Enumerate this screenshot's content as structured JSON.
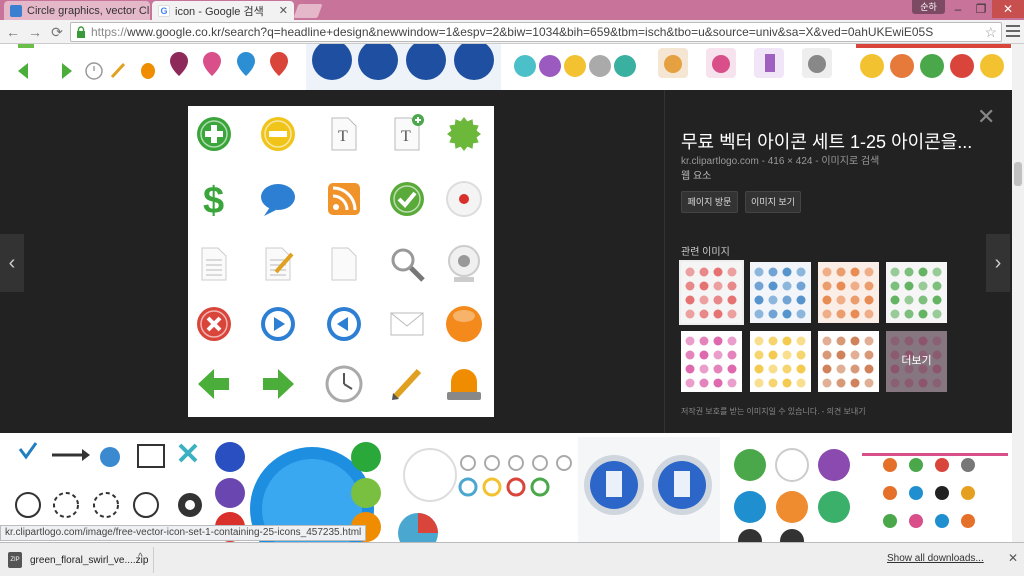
{
  "tabs": [
    {
      "title": "Circle graphics, vector Cli",
      "favicon_color": "#3b7fd0",
      "favicon": "image-icon",
      "active": false
    },
    {
      "title": "icon - Google 검색",
      "favicon_color": "#4285f4",
      "favicon": "google-icon",
      "active": true
    }
  ],
  "window": {
    "profile": "순하",
    "minimize": "–",
    "maximize": "❐",
    "close": "✕"
  },
  "toolbar": {
    "url_scheme": "https://",
    "url_rest": "www.google.co.kr/search?q=headline+design&newwindow=1&espv=2&biw=1034&bih=659&tbm=isch&tbo=u&source=univ&sa=X&ved=0ahUKEwiE05S",
    "back": "←",
    "forward": "→",
    "reload": "⟳",
    "star": "☆"
  },
  "preview": {
    "title": "무료 벡터 아이콘 세트 1-25 아이콘을...",
    "meta": "kr.clipartlogo.com - 416 × 424 - 이미지로 검색",
    "sub": "웹 요소",
    "visit_button": "페이지 방문",
    "view_button": "이미지 보기",
    "related_label": "관련 이미지",
    "more_label": "더보기",
    "copyright": "저작권 보호를 받는 이미지일 수 있습니다.  -  의견 보내기",
    "close": "✕",
    "prev": "‹",
    "next": "›"
  },
  "main_icons": [
    {
      "name": "plus-icon",
      "color": "#3aa53a"
    },
    {
      "name": "minus-icon",
      "color": "#f0c419"
    },
    {
      "name": "text-doc-icon",
      "color": "#bbbbbb"
    },
    {
      "name": "text-add-icon",
      "color": "#bbbbbb"
    },
    {
      "name": "seal-icon",
      "color": "#6cb83a"
    },
    {
      "name": "dollar-icon",
      "color": "#3aa53a"
    },
    {
      "name": "speech-bubble-icon",
      "color": "#2d7fd3"
    },
    {
      "name": "rss-icon",
      "color": "#f0932b"
    },
    {
      "name": "check-icon",
      "color": "#5aaa3a"
    },
    {
      "name": "record-icon",
      "color": "#dddddd"
    },
    {
      "name": "document-icon",
      "color": "#cccccc"
    },
    {
      "name": "edit-document-icon",
      "color": "#cccccc"
    },
    {
      "name": "blank-page-icon",
      "color": "#cccccc"
    },
    {
      "name": "magnifier-icon",
      "color": "#999999"
    },
    {
      "name": "webcam-icon",
      "color": "#cccccc"
    },
    {
      "name": "cancel-icon",
      "color": "#d9453b"
    },
    {
      "name": "play-icon",
      "color": "#2d7fd3"
    },
    {
      "name": "back-icon",
      "color": "#2d7fd3"
    },
    {
      "name": "mail-icon",
      "color": "#dddddd"
    },
    {
      "name": "orange-ball-icon",
      "color": "#f48a1b"
    },
    {
      "name": "arrow-left-icon",
      "color": "#4cae3a"
    },
    {
      "name": "arrow-right-icon",
      "color": "#4cae3a"
    },
    {
      "name": "clock-icon",
      "color": "#aaaaaa"
    },
    {
      "name": "pencil-icon",
      "color": "#e0a020"
    },
    {
      "name": "alarm-light-icon",
      "color": "#f08c00"
    }
  ],
  "related": [
    {
      "bg": "#f5f5f5",
      "dot": "#e35a5a",
      "selected": true
    },
    {
      "bg": "#f2f6fa",
      "dot": "#3b82c4",
      "selected": false
    },
    {
      "bg": "#fbeee6",
      "dot": "#e57a3a",
      "selected": false
    },
    {
      "bg": "#f6f6f6",
      "dot": "#4aa84a",
      "selected": false
    },
    {
      "bg": "#ffffff",
      "dot": "#d84fa0",
      "selected": false
    },
    {
      "bg": "#ffffff",
      "dot": "#f2c230",
      "selected": false
    },
    {
      "bg": "#ffffff",
      "dot": "#c86d3e",
      "selected": false
    },
    {
      "bg": "#c7a4b8",
      "dot": "#d84f8a",
      "selected": false,
      "more": true
    }
  ],
  "status_url": "kr.clipartlogo.com/image/free-vector-icon-set-1-containing-25-icons_457235.html",
  "downloads": {
    "file": "green_floral_swirl_ve....zip",
    "zip_label": "ZIP",
    "caret": "^",
    "show_all": "Show all downloads...",
    "close": "✕"
  }
}
